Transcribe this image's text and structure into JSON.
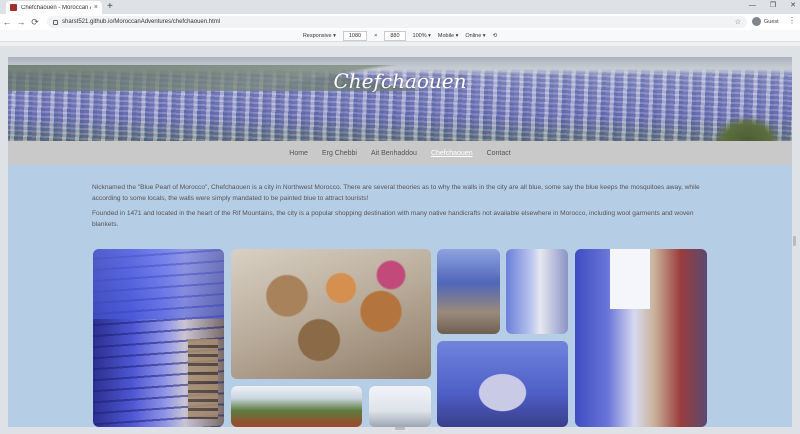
{
  "browser": {
    "tab_title": "Chefchaouen - Moroccan Adve...",
    "tab_close": "×",
    "new_tab": "+",
    "window_controls": [
      "—",
      "❐",
      "✕"
    ],
    "url": "sharst521.github.io/MoroccanAdventures/chefchaouen.html",
    "back": "←",
    "forward": "→",
    "reload": "⟳",
    "star": "☆",
    "profile_name": "Guest",
    "menu": "⋮"
  },
  "devtools": {
    "device": "Responsive ▾",
    "width": "1080",
    "times": "×",
    "height": "880",
    "zoom": "100% ▾",
    "mobile": "Mobile ▾",
    "network": "Online ▾",
    "rotate": "⟲"
  },
  "page": {
    "hero_title": "Chefchaouen",
    "nav": [
      {
        "label": "Home"
      },
      {
        "label": "Erg Chebbi"
      },
      {
        "label": "Ait Benhaddou"
      },
      {
        "label": "Chefchaouen"
      },
      {
        "label": "Contact"
      }
    ],
    "active_nav": "Chefchaouen",
    "paragraphs": [
      "Nicknamed the \"Blue Pearl of Morocco\", Chefchaouen is a city in Northwest Morocco. There are several theories as to why the walls in the city are all blue, some say the blue keeps the mosquitoes away, while according to some locals, the walls were simply mandated to be painted blue to attract tourists!",
      "Founded in 1471 and located in the heart of the Rif Mountains, the city is a popular shopping destination with many native handicrafts not available elsewhere in Morocco, including wool garments and woven blankets."
    ]
  },
  "colors": {
    "page_background": "#b6cde6",
    "nav_background": "#c9c9c9",
    "nav_active": "#ffffff",
    "text": "#555555"
  }
}
